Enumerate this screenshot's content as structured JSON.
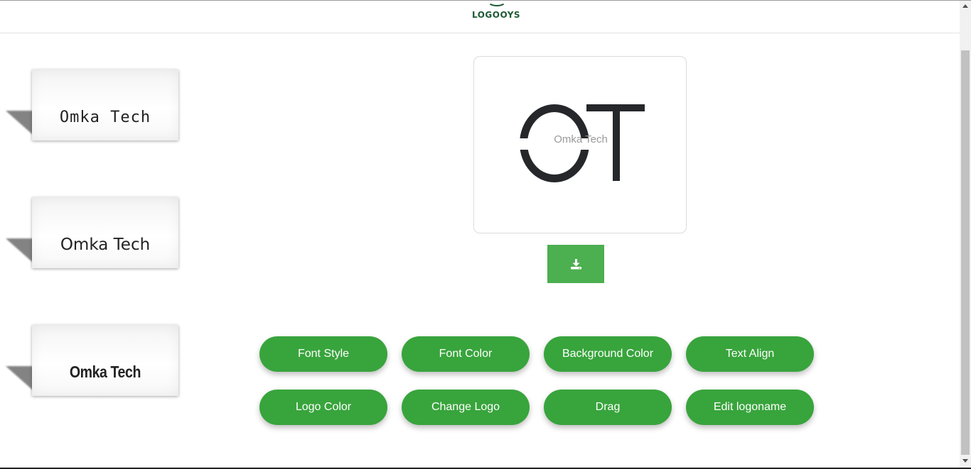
{
  "brand": {
    "name": "LOGOOYS"
  },
  "cards": [
    {
      "label": "Omka Tech"
    },
    {
      "label": "Omka Tech"
    },
    {
      "label": "Omka Tech"
    }
  ],
  "preview": {
    "monogram": "OT",
    "name": "Omka Tech"
  },
  "download": {
    "icon": "download-icon"
  },
  "actions": [
    {
      "label": "Font Style"
    },
    {
      "label": "Font Color"
    },
    {
      "label": "Background Color"
    },
    {
      "label": "Text Align"
    },
    {
      "label": "Logo Color"
    },
    {
      "label": "Change Logo"
    },
    {
      "label": "Drag"
    },
    {
      "label": "Edit logoname"
    }
  ],
  "colors": {
    "accent": "#38a43c",
    "download": "#4caf50",
    "brand": "#1c5a32",
    "logo_ink": "#25272a"
  }
}
